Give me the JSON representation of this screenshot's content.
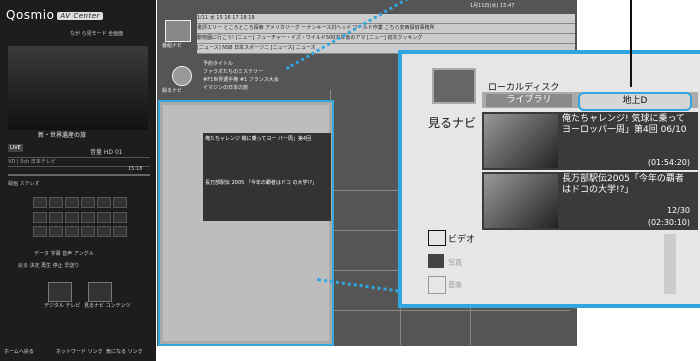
{
  "left": {
    "logo": "Qosmio",
    "logo_tag": "AV Center",
    "modes": "なが ら見モード  全画面",
    "program_title": "新・世界遺産の旅",
    "live": "LIVE",
    "status": "音量 HD 01",
    "channel_row": "VD | 5ch 日本テレビ",
    "time": "15:18",
    "control_label": "録画 ステレオ",
    "fn_labels": "データ 字幕 音声 アングル",
    "fn_labels2": "戻る  決定  再生  停止  早送り",
    "tv_label1": "デジタル\nテレビ",
    "tv_label2": "見るナビ\nコンテンツ",
    "bottom": [
      "ホームへ戻る",
      "ホットワード リンク",
      "気になる リンク"
    ]
  },
  "main": {
    "top_info": "1月11日(水) 15:47",
    "nav_label": "番組ナビ",
    "epg_rows": [
      "1/11 水  15  16  17  18  19",
      "書評エリー  ところところ探索  アメリカリーグ  ーナンキース対ヘッド  ワールド作業  こちら安西探偵事務所",
      "動物園に行こう!  [ニュー]  フューチャー・イズ・ワイルド500万年後のアマ  [ニュー]  初次クッキング",
      "[ニュース] NSB 日本スポーツニ [ニュース] ニュース"
    ],
    "rec_label": "録るナビ",
    "rec_rows": [
      "予約タイトル",
      "ファラオたちのミステリー",
      "#F1世界選手権 #1 フランス大会",
      "イマジンの日本の旅"
    ],
    "small_items": [
      "俺たちャレンジ 機に乗ってヨー バー周」第4回",
      "長万部駅伝 2005 「今年の覇者はドコ の大学!?」"
    ]
  },
  "zoom": {
    "nav_label": "見るナビ",
    "local_disk": "ローカルディスク",
    "tab_library": "ライブラリ",
    "tab_digital": "地上D",
    "items": [
      {
        "title": "俺たちャレンジ! 気球に乗ってヨーロッパ一周」第4回 06/10",
        "time": "(01:54:20)"
      },
      {
        "title": "長万部駅伝2005「今年の覇者はドコの大学!?」",
        "date": "12/30",
        "time": "(02:30:10)"
      }
    ],
    "video_label": "ビデオ",
    "photo_label": "写真",
    "music_label": "音楽"
  },
  "colors": {
    "accent": "#2fa6e0",
    "panel_dark": "#1d1d1d",
    "main_bg": "#555555"
  }
}
